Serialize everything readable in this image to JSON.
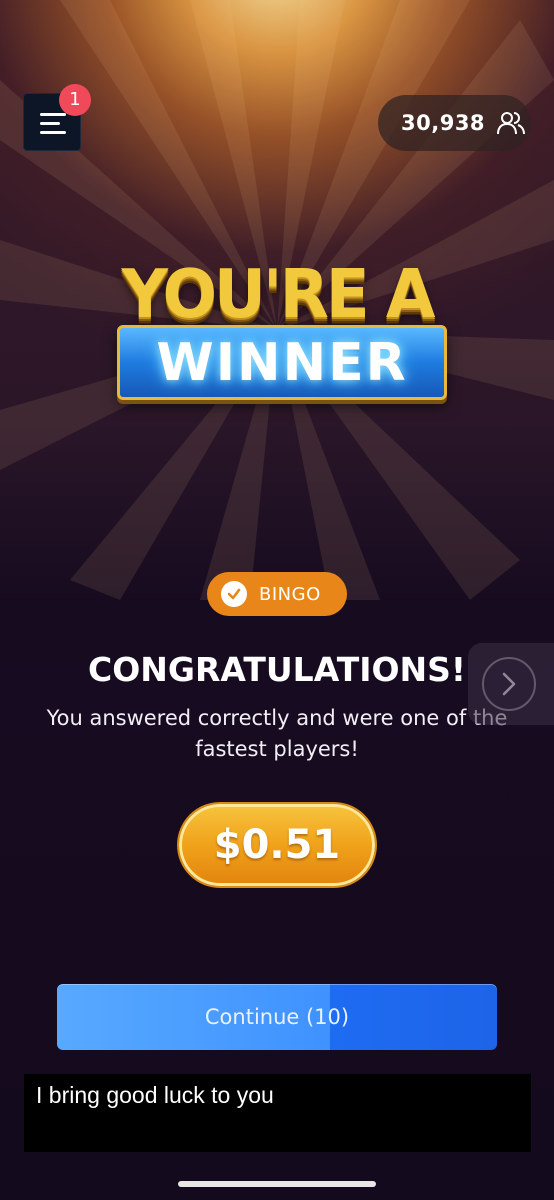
{
  "header": {
    "notification_count": "1",
    "player_count": "30,938"
  },
  "banner": {
    "line1": "YOU'RE A",
    "line2": "WINNER"
  },
  "result": {
    "badge_label": "BINGO",
    "heading": "CONGRATULATIONS!",
    "message": "You answered correctly and were one of the fastest players!",
    "prize": "$0.51"
  },
  "actions": {
    "continue_label": "Continue (10)"
  },
  "caption": {
    "text": "I bring good luck to you"
  },
  "colors": {
    "accent_orange": "#e8861a",
    "button_blue": "#3f92ff",
    "badge_red": "#f04a5a",
    "prize_gold": "#f0a21b"
  }
}
